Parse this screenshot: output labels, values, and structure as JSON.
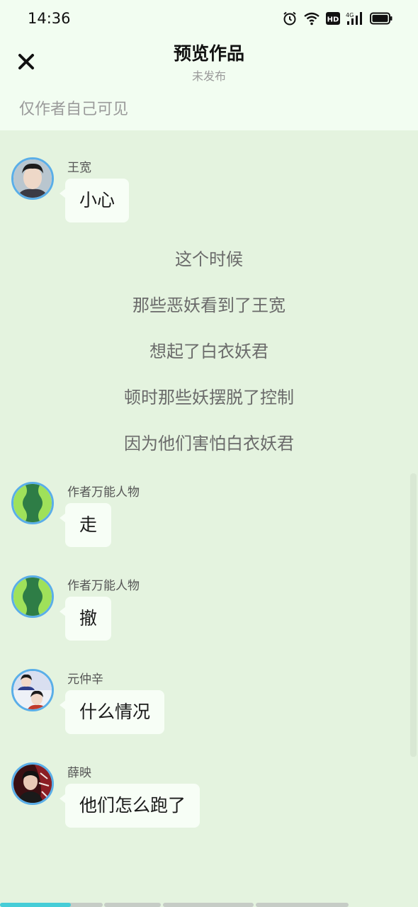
{
  "status_bar": {
    "time": "14:36",
    "icons": [
      "alarm-icon",
      "wifi-icon",
      "hd-icon",
      "signal-4g-icon",
      "battery-icon"
    ],
    "hd_label": "HD",
    "network_label": "4G"
  },
  "header": {
    "close_icon": "close-icon",
    "title": "预览作品",
    "subtitle": "未发布",
    "visibility_note": "仅作者自己可见"
  },
  "messages": [
    {
      "sender": "王宽",
      "text": "小心",
      "avatar": "wang-kuan-avatar"
    },
    {
      "sender": "作者万能人物",
      "text": "走",
      "avatar": "generic-character-avatar"
    },
    {
      "sender": "作者万能人物",
      "text": "撤",
      "avatar": "generic-character-avatar"
    },
    {
      "sender": "元仲辛",
      "text": "什么情况",
      "avatar": "yuan-zhongxin-avatar"
    },
    {
      "sender": "薛映",
      "text": "他们怎么跑了",
      "avatar": "xue-ying-avatar"
    }
  ],
  "narration": [
    "这个时候",
    "那些恶妖看到了王宽",
    "想起了白衣妖君",
    "顿时那些妖摆脱了控制",
    "因为他们害怕白衣妖君"
  ],
  "progress": {
    "segments": 4,
    "current_segment": 1,
    "current_fill": 0.69
  },
  "colors": {
    "background": "#e4f3df",
    "header_background": "#f2fdf1",
    "bubble": "#f7fef6",
    "avatar_border": "#5aaee8",
    "progress_active": "#46cdd7",
    "progress_inactive": "#c6ccc6"
  }
}
